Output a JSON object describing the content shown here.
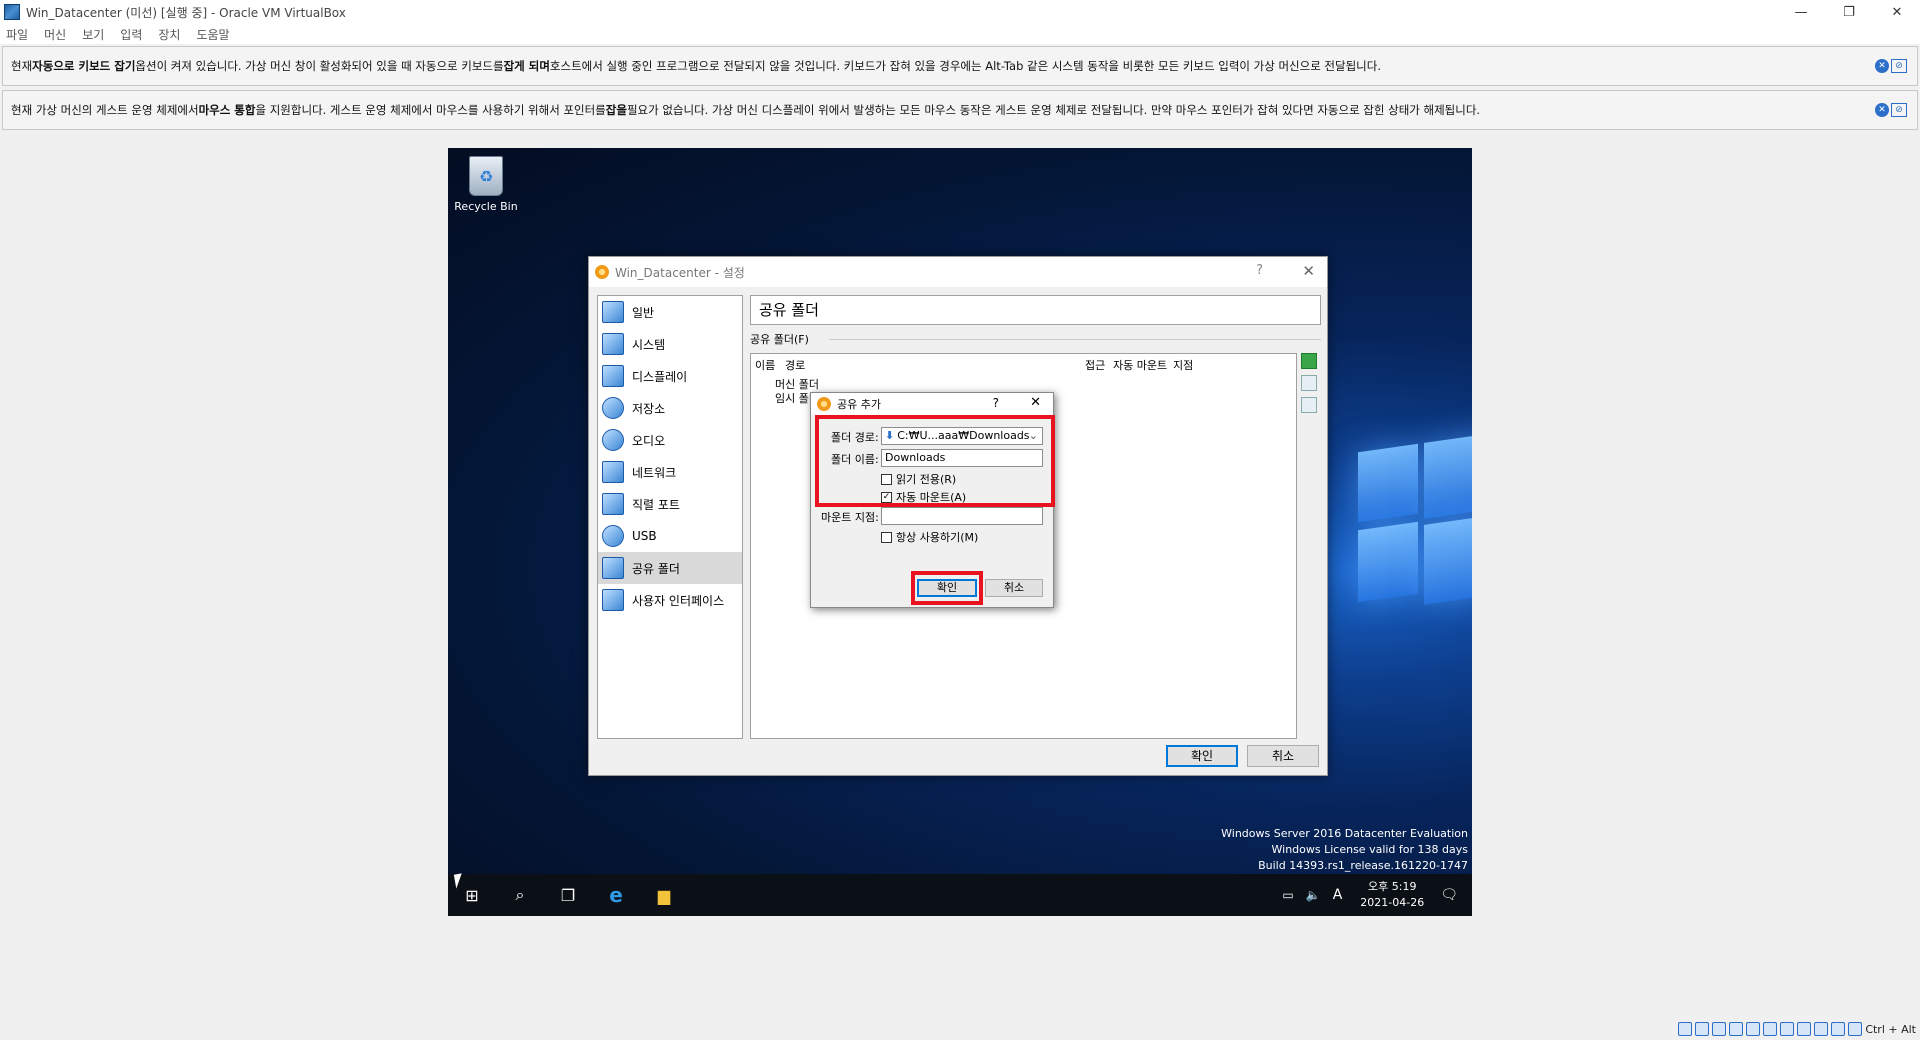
{
  "window": {
    "title": "Win_Datacenter (미선) [실행 중] - Oracle VM VirtualBox",
    "minimize": "—",
    "restore": "❐",
    "close": "✕"
  },
  "menubar": [
    "파일",
    "머신",
    "보기",
    "입력",
    "장치",
    "도움말"
  ],
  "infobars": {
    "keyboard": {
      "p1": "현재 ",
      "b1": "자동으로 키보드 잡기",
      "p2": " 옵션이 켜져 있습니다. 가상 머신 창이 활성화되어 있을 때 자동으로 키보드를 ",
      "b2": "잡게 되며",
      "p3": " 호스트에서 실행 중인 프로그램으로 전달되지 않을 것입니다. 키보드가 잡혀 있을 경우에는 Alt-Tab 같은 시스템 동작을 비롯한 모든 키보드 입력이 가상 머신으로 전달됩니다."
    },
    "mouse": {
      "p1": "현재 가상 머신의 게스트 운영 체제에서 ",
      "b1": "마우스 통합",
      "p2": "을 지원합니다. 게스트 운영 체제에서 마우스를 사용하기 위해서 포인터를 ",
      "b2": "잡을",
      "p3": " 필요가 없습니다. 가상 머신 디스플레이 위에서 발생하는 모든 마우스 동작은 게스트 운영 체제로 전달됩니다. 만약 마우스 포인터가 잡혀 있다면 자동으로 잡힌 상태가 해제됩니다."
    }
  },
  "desktop": {
    "recycle_bin": "Recycle Bin",
    "watermark": [
      "Windows Server 2016 Datacenter Evaluation",
      "Windows License valid for 138 days",
      "Build 14393.rs1_release.161220-1747"
    ],
    "clock_time": "오후 5:19",
    "clock_date": "2021-04-26",
    "ime": "A"
  },
  "settings": {
    "title": "Win_Datacenter - 설정",
    "help": "?",
    "close": "✕",
    "categories": [
      "일반",
      "시스템",
      "디스플레이",
      "저장소",
      "오디오",
      "네트워크",
      "직렬 포트",
      "USB",
      "공유 폴더",
      "사용자 인터페이스"
    ],
    "active_category": "공유 폴더",
    "page_title": "공유 폴더",
    "group_label": "공유 폴더(F)",
    "columns": [
      "이름",
      "경로",
      "접근",
      "자동 마운트",
      "지점"
    ],
    "rows": [
      "머신 폴더",
      "임시 폴더"
    ],
    "ok": "확인",
    "cancel": "취소"
  },
  "add_share": {
    "title": "공유 추가",
    "help": "?",
    "close": "✕",
    "path_label": "폴더 경로:",
    "path_value": "C:₩U...aaa₩Downloads",
    "name_label": "폴더 이름:",
    "name_value": "Downloads",
    "readonly_label": "읽기 전용(R)",
    "readonly_checked": false,
    "automount_label": "자동 마운트(A)",
    "automount_checked": true,
    "mountpoint_label": "마운트 지점:",
    "mountpoint_value": "",
    "permanent_label": "항상 사용하기(M)",
    "permanent_checked": false,
    "ok": "확인",
    "cancel": "취소"
  },
  "statusbar": {
    "host_key": "Ctrl + Alt"
  },
  "colors": {
    "highlight": "#e8131f",
    "accent": "#0078d7"
  }
}
